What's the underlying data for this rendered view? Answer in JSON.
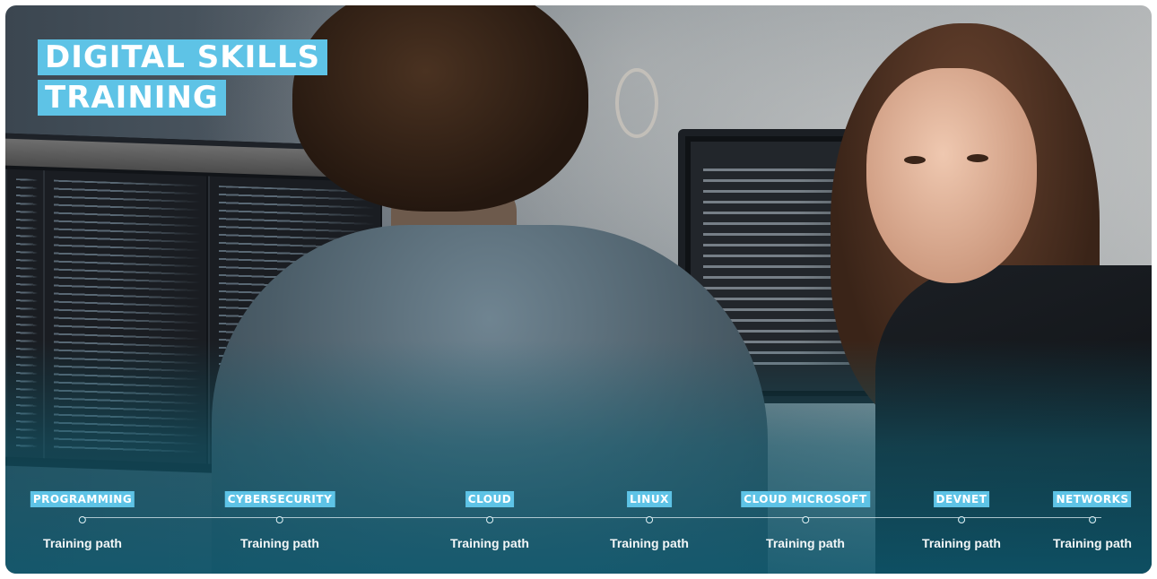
{
  "banner": {
    "title_lines": [
      "DIGITAL SKILLS",
      "TRAINING"
    ],
    "accent_color": "#5ec3e6"
  },
  "timeline": {
    "items": [
      {
        "badge": "PROGRAMMING",
        "label": "Training path"
      },
      {
        "badge": "CYBERSECURITY",
        "label": "Training path"
      },
      {
        "badge": "CLOUD",
        "label": "Training path"
      },
      {
        "badge": "LINUX",
        "label": "Training path"
      },
      {
        "badge": "CLOUD MICROSOFT",
        "label": "Training path"
      },
      {
        "badge": "DEVNET",
        "label": "Training path"
      },
      {
        "badge": "NETWORKS",
        "label": "Training path"
      }
    ]
  }
}
